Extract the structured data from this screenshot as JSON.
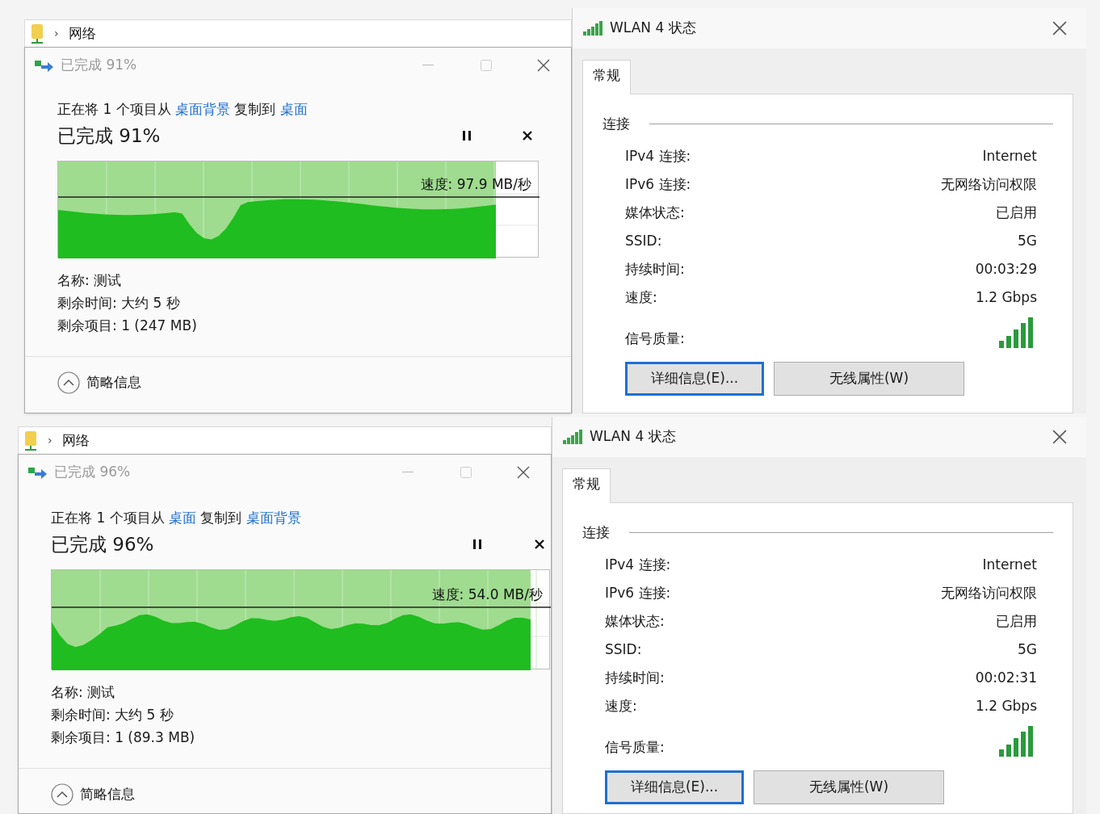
{
  "copy_dialogs": [
    {
      "breadcrumb_separator": "›",
      "breadcrumb": "网络",
      "title": "已完成 91%",
      "message": {
        "prefix": "正在将 1 个项目从",
        "source": "桌面背景",
        "middle": "复制到",
        "destination": "桌面"
      },
      "heading": "已完成 91%",
      "speed": "速度: 97.9 MB/秒",
      "level": 0.91,
      "details": [
        "名称: 测试",
        "剩余时间: 大约 5 秒",
        "剩余项目: 1 (247 MB)"
      ],
      "less_details": "简略信息"
    },
    {
      "breadcrumb_separator": "›",
      "breadcrumb": "网络",
      "title": "已完成 96%",
      "message": {
        "prefix": "正在将 1 个项目从",
        "source": "桌面",
        "middle": "复制到",
        "destination": "桌面背景"
      },
      "heading": "已完成 96%",
      "speed": "速度: 54.0 MB/秒",
      "level": 0.96,
      "details": [
        "名称: 测试",
        "剩余时间: 大约 5 秒",
        "剩余项目: 1 (89.3 MB)"
      ],
      "less_details": "简略信息"
    }
  ],
  "wlan_dialogs": [
    {
      "title": "WLAN 4 状态",
      "tabs": [
        {
          "label": "常规",
          "selected": true
        }
      ],
      "section": "连接",
      "rows": [
        {
          "label": "IPv4 连接:",
          "value": "Internet"
        },
        {
          "label": "IPv6 连接:",
          "value": "无网络访问权限"
        },
        {
          "label": "媒体状态:",
          "value": "已启用"
        },
        {
          "label": "SSID:",
          "value": "5G"
        },
        {
          "label": "持续时间:",
          "value": "00:03:29"
        },
        {
          "label": "速度:",
          "value": "1.2 Gbps"
        }
      ],
      "signal_label": "信号质量:",
      "buttons": [
        {
          "label": "详细信息(E)...",
          "focused": true
        },
        {
          "label": "无线属性(W)",
          "focused": false
        }
      ]
    },
    {
      "title": "WLAN 4 状态",
      "tabs": [
        {
          "label": "常规",
          "selected": true
        }
      ],
      "section": "连接",
      "rows": [
        {
          "label": "IPv4 连接:",
          "value": "Internet"
        },
        {
          "label": "IPv6 连接:",
          "value": "无网络访问权限"
        },
        {
          "label": "媒体状态:",
          "value": "已启用"
        },
        {
          "label": "SSID:",
          "value": "5G"
        },
        {
          "label": "持续时间:",
          "value": "00:02:31"
        },
        {
          "label": "速度:",
          "value": "1.2 Gbps"
        }
      ],
      "signal_label": "信号质量:",
      "buttons": [
        {
          "label": "详细信息(E)...",
          "focused": true
        },
        {
          "label": "无线属性(W)",
          "focused": false
        }
      ]
    }
  ]
}
